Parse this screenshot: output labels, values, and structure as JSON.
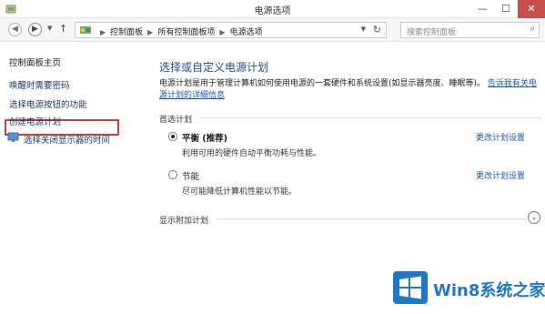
{
  "window": {
    "title": "电源选项",
    "minimize_glyph": "—",
    "maximize_glyph": "☐",
    "close_glyph": "✕"
  },
  "address_bar": {
    "crumbs": [
      "控制面板",
      "所有控制面板项",
      "电源选项"
    ],
    "search_placeholder": "搜索控制面板"
  },
  "sidebar": {
    "home": "控制面板主页",
    "links": [
      "唤醒时需要密码",
      "选择电源按钮的功能",
      "创建电源计划",
      "选择关闭显示器的时间"
    ],
    "highlighted_index": 0
  },
  "main": {
    "title": "选择或自定义电源计划",
    "description": "电源计划是用于管理计算机如何使用电源的一套硬件和系统设置(如显示器亮度、睡眠等)。",
    "description_link": "告诉我有关电源计划的详细信息",
    "preferred_header": "首选计划",
    "plans": [
      {
        "name": "平衡 (推荐)",
        "description": "利用可用的硬件自动平衡功耗与性能。",
        "selected": true,
        "change_label": "更改计划设置"
      },
      {
        "name": "节能",
        "description": "尽可能降低计算机性能以节能。",
        "selected": false,
        "change_label": "更改计划设置"
      }
    ],
    "show_more": "显示附加计划"
  },
  "watermark": {
    "text": "Win8系统之家"
  },
  "colors": {
    "title_blue": "#1f4e93",
    "link_blue": "#1a55b5",
    "highlight_red": "#d03f36",
    "close_red": "#c7504a",
    "watermark_blue": "#1e78c8"
  }
}
